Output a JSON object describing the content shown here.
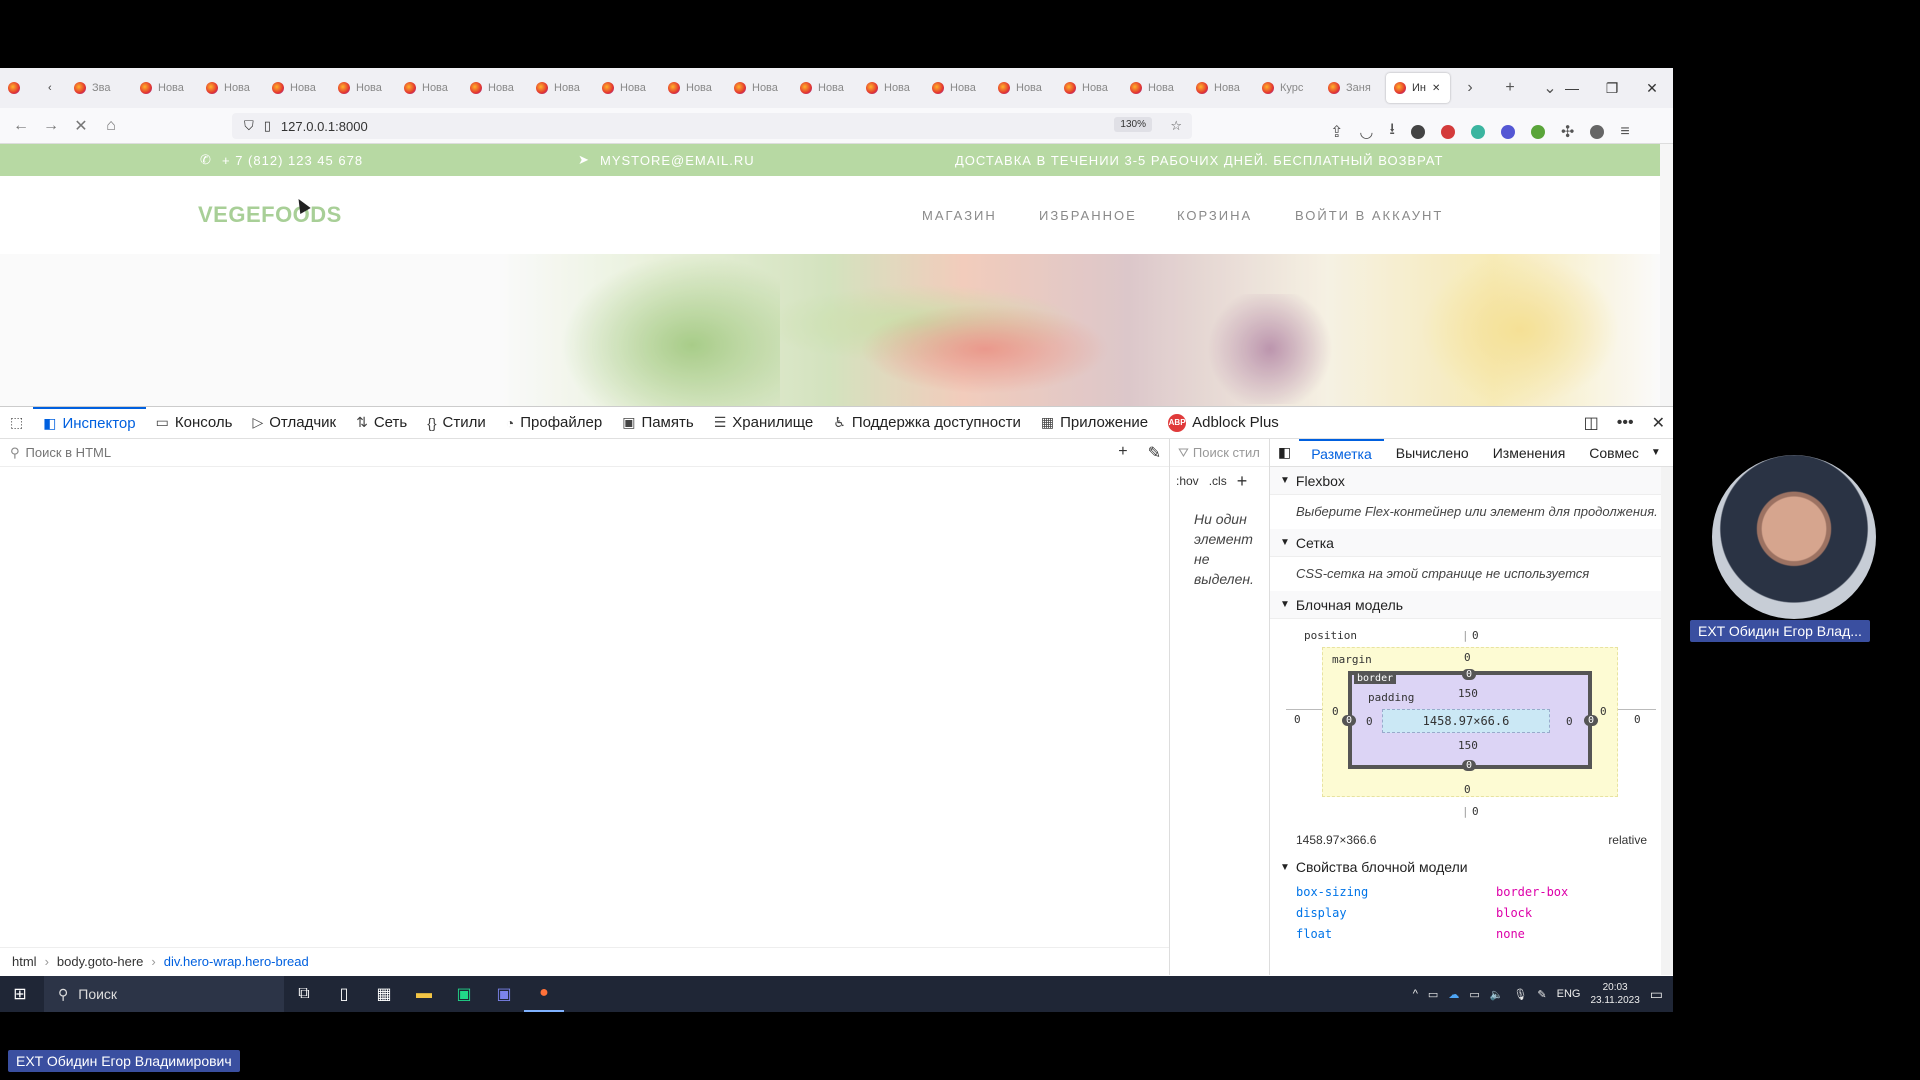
{
  "browser": {
    "tabs": [
      {
        "label": "Зва"
      },
      {
        "label": "Нова"
      },
      {
        "label": "Нова"
      },
      {
        "label": "Нова"
      },
      {
        "label": "Нова"
      },
      {
        "label": "Нова"
      },
      {
        "label": "Нова"
      },
      {
        "label": "Нова"
      },
      {
        "label": "Нова"
      },
      {
        "label": "Нова"
      },
      {
        "label": "Нова"
      },
      {
        "label": "Нова"
      },
      {
        "label": "Нова"
      },
      {
        "label": "Нова"
      },
      {
        "label": "Нова"
      },
      {
        "label": "Нова"
      },
      {
        "label": "Нова"
      },
      {
        "label": "Нова"
      },
      {
        "label": "Курс"
      },
      {
        "label": "Заня"
      },
      {
        "label": "Ин"
      }
    ],
    "url": "127.0.0.1:8000",
    "zoom": "130%"
  },
  "site": {
    "phone": "+ 7 (812) 123 45 678",
    "email": "MYSTORE@EMAIL.RU",
    "delivery": "ДОСТАВКА В ТЕЧЕНИИ 3-5 РАБОЧИХ ДНЕЙ. БЕСПЛАТНЫЙ ВОЗВРАТ",
    "logo": "VEGEFOODS",
    "menu": [
      "МАГАЗИН",
      "ИЗБРАННОЕ",
      "КОРЗИНА",
      "ВОЙТИ В АККАУНТ"
    ]
  },
  "devtools": {
    "tabs": [
      "Инспектор",
      "Консоль",
      "Отладчик",
      "Сеть",
      "Стили",
      "Профайлер",
      "Память",
      "Хранилище",
      "Поддержка доступности",
      "Приложение",
      "Adblock Plus"
    ],
    "html_search_placeholder": "Поиск в HTML",
    "breadcrumb": [
      "html",
      "body.goto-here",
      "div.hero-wrap.hero-bread"
    ],
    "rules_search_placeholder": "Поиск стил",
    "rules_hov": ":hov",
    "rules_cls": ".cls",
    "no_element": "Ни один элемент не выделен.",
    "layout_tabs": [
      "Разметка",
      "Вычислено",
      "Изменения",
      "Совмес"
    ],
    "flexbox_title": "Flexbox",
    "flexbox_text": "Выберите Flex-контейнер или элемент для продолжения.",
    "grid_title": "Сетка",
    "grid_text": "CSS-сетка на этой странице не используется",
    "boxmodel_title": "Блочная модель",
    "boxmodel": {
      "position_label": "position",
      "margin_label": "margin",
      "border_label": "border",
      "padding_label": "padding",
      "position_top": "0",
      "position_bottom": "0",
      "position_left": "0",
      "position_right": "0",
      "margin_top": "0",
      "margin_bottom": "0",
      "margin_left": "0",
      "margin_right": "0",
      "border_top": "0",
      "border_bottom": "0",
      "border_left": "0",
      "border_right": "0",
      "padding_top": "150",
      "padding_bottom": "150",
      "padding_left": "0",
      "padding_right": "0",
      "content": "1458.97×66.6",
      "size": "1458.97×366.6",
      "position_value": "relative"
    },
    "props_title": "Свойства блочной модели",
    "props": [
      {
        "name": "box-sizing",
        "value": "border-box"
      },
      {
        "name": "display",
        "value": "block"
      },
      {
        "name": "float",
        "value": "none"
      }
    ]
  },
  "taskbar": {
    "search": "Поиск",
    "lang": "ENG",
    "time": "20:03",
    "date": "23.11.2023"
  },
  "overlay": {
    "cam_name": "EXT Обидин Егор Влад...",
    "full_name": "EXT Обидин Егор Владимирович"
  },
  "colors": {
    "accent": "#0060df",
    "site_green": "#b7d9a3",
    "taskbar": "#1f2636"
  }
}
